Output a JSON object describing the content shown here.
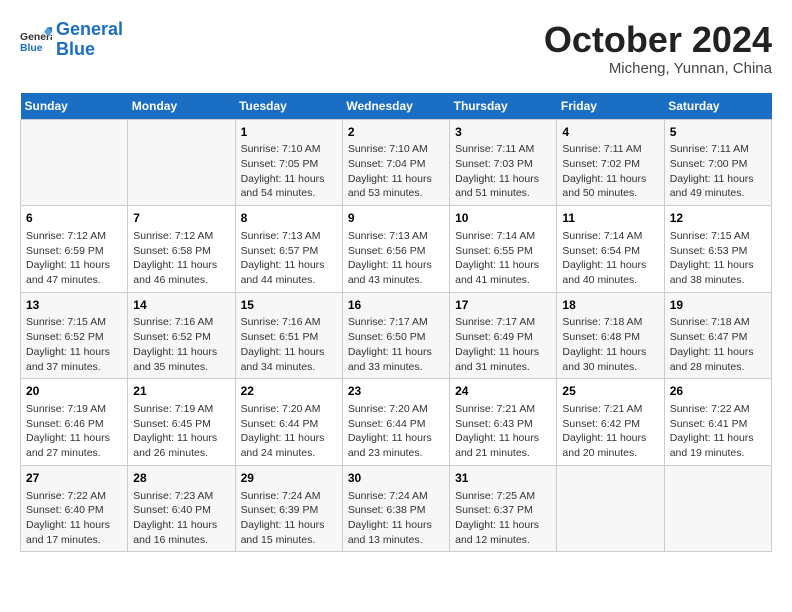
{
  "header": {
    "logo_line1": "General",
    "logo_line2": "Blue",
    "month_title": "October 2024",
    "location": "Micheng, Yunnan, China"
  },
  "days_of_week": [
    "Sunday",
    "Monday",
    "Tuesday",
    "Wednesday",
    "Thursday",
    "Friday",
    "Saturday"
  ],
  "weeks": [
    [
      {
        "day": "",
        "info": ""
      },
      {
        "day": "",
        "info": ""
      },
      {
        "day": "1",
        "info": "Sunrise: 7:10 AM\nSunset: 7:05 PM\nDaylight: 11 hours and 54 minutes."
      },
      {
        "day": "2",
        "info": "Sunrise: 7:10 AM\nSunset: 7:04 PM\nDaylight: 11 hours and 53 minutes."
      },
      {
        "day": "3",
        "info": "Sunrise: 7:11 AM\nSunset: 7:03 PM\nDaylight: 11 hours and 51 minutes."
      },
      {
        "day": "4",
        "info": "Sunrise: 7:11 AM\nSunset: 7:02 PM\nDaylight: 11 hours and 50 minutes."
      },
      {
        "day": "5",
        "info": "Sunrise: 7:11 AM\nSunset: 7:00 PM\nDaylight: 11 hours and 49 minutes."
      }
    ],
    [
      {
        "day": "6",
        "info": "Sunrise: 7:12 AM\nSunset: 6:59 PM\nDaylight: 11 hours and 47 minutes."
      },
      {
        "day": "7",
        "info": "Sunrise: 7:12 AM\nSunset: 6:58 PM\nDaylight: 11 hours and 46 minutes."
      },
      {
        "day": "8",
        "info": "Sunrise: 7:13 AM\nSunset: 6:57 PM\nDaylight: 11 hours and 44 minutes."
      },
      {
        "day": "9",
        "info": "Sunrise: 7:13 AM\nSunset: 6:56 PM\nDaylight: 11 hours and 43 minutes."
      },
      {
        "day": "10",
        "info": "Sunrise: 7:14 AM\nSunset: 6:55 PM\nDaylight: 11 hours and 41 minutes."
      },
      {
        "day": "11",
        "info": "Sunrise: 7:14 AM\nSunset: 6:54 PM\nDaylight: 11 hours and 40 minutes."
      },
      {
        "day": "12",
        "info": "Sunrise: 7:15 AM\nSunset: 6:53 PM\nDaylight: 11 hours and 38 minutes."
      }
    ],
    [
      {
        "day": "13",
        "info": "Sunrise: 7:15 AM\nSunset: 6:52 PM\nDaylight: 11 hours and 37 minutes."
      },
      {
        "day": "14",
        "info": "Sunrise: 7:16 AM\nSunset: 6:52 PM\nDaylight: 11 hours and 35 minutes."
      },
      {
        "day": "15",
        "info": "Sunrise: 7:16 AM\nSunset: 6:51 PM\nDaylight: 11 hours and 34 minutes."
      },
      {
        "day": "16",
        "info": "Sunrise: 7:17 AM\nSunset: 6:50 PM\nDaylight: 11 hours and 33 minutes."
      },
      {
        "day": "17",
        "info": "Sunrise: 7:17 AM\nSunset: 6:49 PM\nDaylight: 11 hours and 31 minutes."
      },
      {
        "day": "18",
        "info": "Sunrise: 7:18 AM\nSunset: 6:48 PM\nDaylight: 11 hours and 30 minutes."
      },
      {
        "day": "19",
        "info": "Sunrise: 7:18 AM\nSunset: 6:47 PM\nDaylight: 11 hours and 28 minutes."
      }
    ],
    [
      {
        "day": "20",
        "info": "Sunrise: 7:19 AM\nSunset: 6:46 PM\nDaylight: 11 hours and 27 minutes."
      },
      {
        "day": "21",
        "info": "Sunrise: 7:19 AM\nSunset: 6:45 PM\nDaylight: 11 hours and 26 minutes."
      },
      {
        "day": "22",
        "info": "Sunrise: 7:20 AM\nSunset: 6:44 PM\nDaylight: 11 hours and 24 minutes."
      },
      {
        "day": "23",
        "info": "Sunrise: 7:20 AM\nSunset: 6:44 PM\nDaylight: 11 hours and 23 minutes."
      },
      {
        "day": "24",
        "info": "Sunrise: 7:21 AM\nSunset: 6:43 PM\nDaylight: 11 hours and 21 minutes."
      },
      {
        "day": "25",
        "info": "Sunrise: 7:21 AM\nSunset: 6:42 PM\nDaylight: 11 hours and 20 minutes."
      },
      {
        "day": "26",
        "info": "Sunrise: 7:22 AM\nSunset: 6:41 PM\nDaylight: 11 hours and 19 minutes."
      }
    ],
    [
      {
        "day": "27",
        "info": "Sunrise: 7:22 AM\nSunset: 6:40 PM\nDaylight: 11 hours and 17 minutes."
      },
      {
        "day": "28",
        "info": "Sunrise: 7:23 AM\nSunset: 6:40 PM\nDaylight: 11 hours and 16 minutes."
      },
      {
        "day": "29",
        "info": "Sunrise: 7:24 AM\nSunset: 6:39 PM\nDaylight: 11 hours and 15 minutes."
      },
      {
        "day": "30",
        "info": "Sunrise: 7:24 AM\nSunset: 6:38 PM\nDaylight: 11 hours and 13 minutes."
      },
      {
        "day": "31",
        "info": "Sunrise: 7:25 AM\nSunset: 6:37 PM\nDaylight: 11 hours and 12 minutes."
      },
      {
        "day": "",
        "info": ""
      },
      {
        "day": "",
        "info": ""
      }
    ]
  ]
}
